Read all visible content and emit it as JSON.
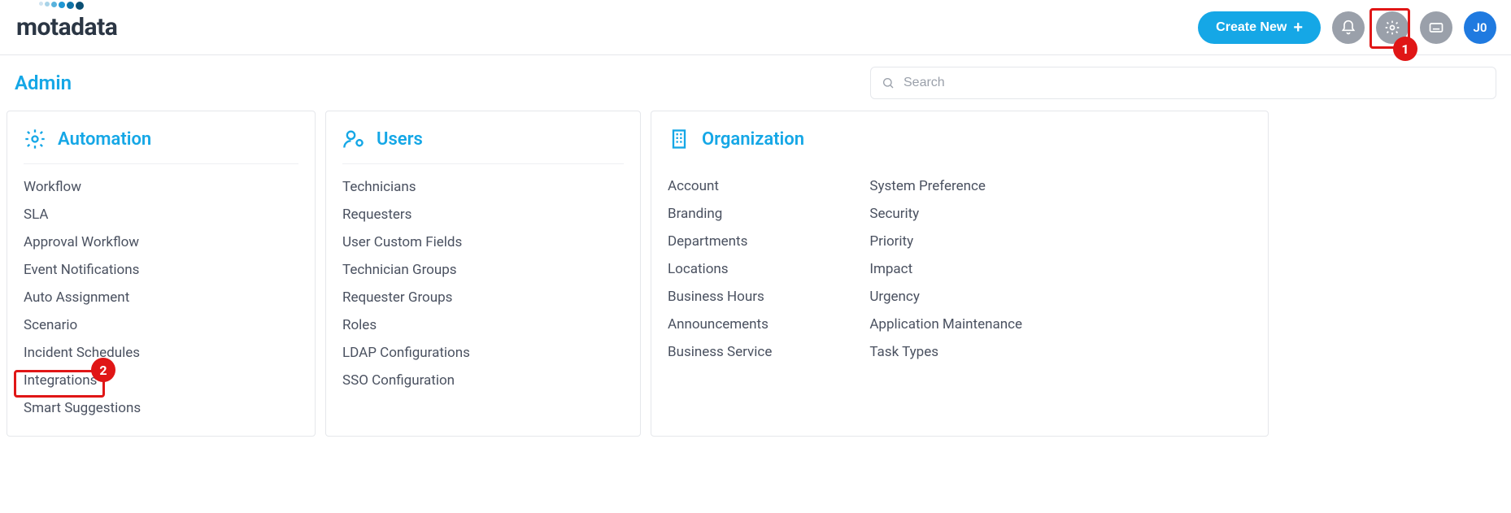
{
  "header": {
    "logo_text": "motadata",
    "create_label": "Create New",
    "avatar_initials": "J0"
  },
  "callouts": {
    "settings_badge": "1",
    "integrations_badge": "2"
  },
  "page": {
    "title": "Admin",
    "search_placeholder": "Search"
  },
  "cards": {
    "automation": {
      "title": "Automation",
      "links": [
        "Workflow",
        "SLA",
        "Approval Workflow",
        "Event Notifications",
        "Auto Assignment",
        "Scenario",
        "Incident Schedules",
        "Integrations",
        "Smart Suggestions"
      ]
    },
    "users": {
      "title": "Users",
      "links": [
        "Technicians",
        "Requesters",
        "User Custom Fields",
        "Technician Groups",
        "Requester Groups",
        "Roles",
        "LDAP Configurations",
        "SSO Configuration"
      ]
    },
    "organization": {
      "title": "Organization",
      "col1": [
        "Account",
        "Branding",
        "Departments",
        "Locations",
        "Business Hours",
        "Announcements",
        "Business Service"
      ],
      "col2": [
        "System Preference",
        "Security",
        "Priority",
        "Impact",
        "Urgency",
        "Application Maintenance",
        "Task Types"
      ]
    }
  }
}
